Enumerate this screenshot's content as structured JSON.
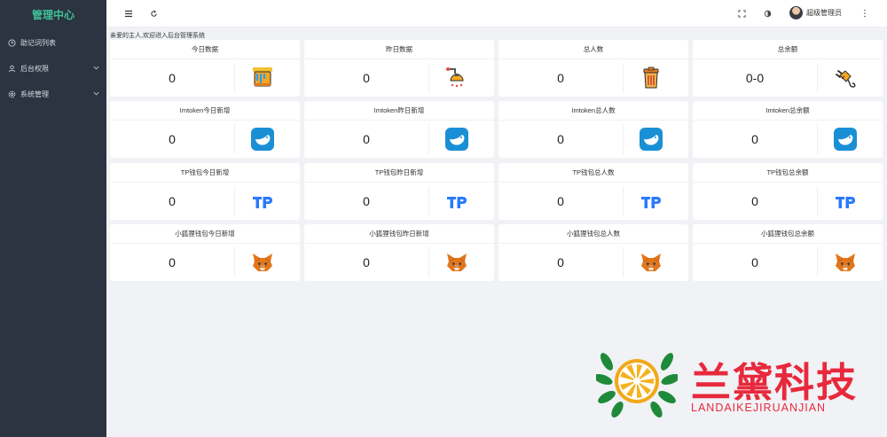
{
  "sidebar": {
    "title": "管理中心",
    "items": [
      {
        "label": "助记词列表",
        "icon": "clock-icon",
        "has_arrow": false
      },
      {
        "label": "后台权限",
        "icon": "user-icon",
        "has_arrow": true
      },
      {
        "label": "系统管理",
        "icon": "gear-icon",
        "has_arrow": true
      }
    ]
  },
  "header": {
    "menu_icon": "hamburger-icon",
    "refresh_icon": "refresh-icon",
    "fullscreen_icon": "fullscreen-icon",
    "theme_icon": "theme-icon",
    "username": "超级管理员",
    "more_icon": "more-vertical-icon"
  },
  "notice": "亲爱的主人,欢迎进入后台管理系统",
  "cards": [
    {
      "title": "今日数据",
      "value": "0",
      "icon": "paint-bucket-icon"
    },
    {
      "title": "昨日数据",
      "value": "0",
      "icon": "shower-icon"
    },
    {
      "title": "总人数",
      "value": "0",
      "icon": "trash-bin-icon"
    },
    {
      "title": "总余额",
      "value": "0-0",
      "icon": "plug-icon"
    },
    {
      "title": "Imtoken今日新增",
      "value": "0",
      "icon": "imtoken-logo-icon"
    },
    {
      "title": "Imtoken昨日新增",
      "value": "0",
      "icon": "imtoken-logo-icon"
    },
    {
      "title": "Imtoken总人数",
      "value": "0",
      "icon": "imtoken-logo-icon"
    },
    {
      "title": "Imtoken总余额",
      "value": "0",
      "icon": "imtoken-logo-icon"
    },
    {
      "title": "TP钱包今日新增",
      "value": "0",
      "icon": "tp-logo-icon"
    },
    {
      "title": "TP钱包昨日新增",
      "value": "0",
      "icon": "tp-logo-icon"
    },
    {
      "title": "TP钱包总人数",
      "value": "0",
      "icon": "tp-logo-icon"
    },
    {
      "title": "TP钱包总余额",
      "value": "0",
      "icon": "tp-logo-icon"
    },
    {
      "title": "小狐狸钱包今日新增",
      "value": "0",
      "icon": "metamask-fox-icon"
    },
    {
      "title": "小狐狸钱包昨日新增",
      "value": "0",
      "icon": "metamask-fox-icon"
    },
    {
      "title": "小狐狸钱包总人数",
      "value": "0",
      "icon": "metamask-fox-icon"
    },
    {
      "title": "小狐狸钱包总余额",
      "value": "0",
      "icon": "metamask-fox-icon"
    }
  ],
  "watermark": {
    "title": "兰黛科技",
    "subtitle": "LANDAIKEJIRUANJIAN",
    "color": "#e8293d"
  },
  "colors": {
    "sidebar_bg": "#2b3440",
    "brand_green": "#3fc29a",
    "page_bg": "#f0f2f5",
    "imtoken_blue": "#1a8fd6",
    "tp_blue": "#2a79ff",
    "fox_orange": "#e2761b"
  }
}
